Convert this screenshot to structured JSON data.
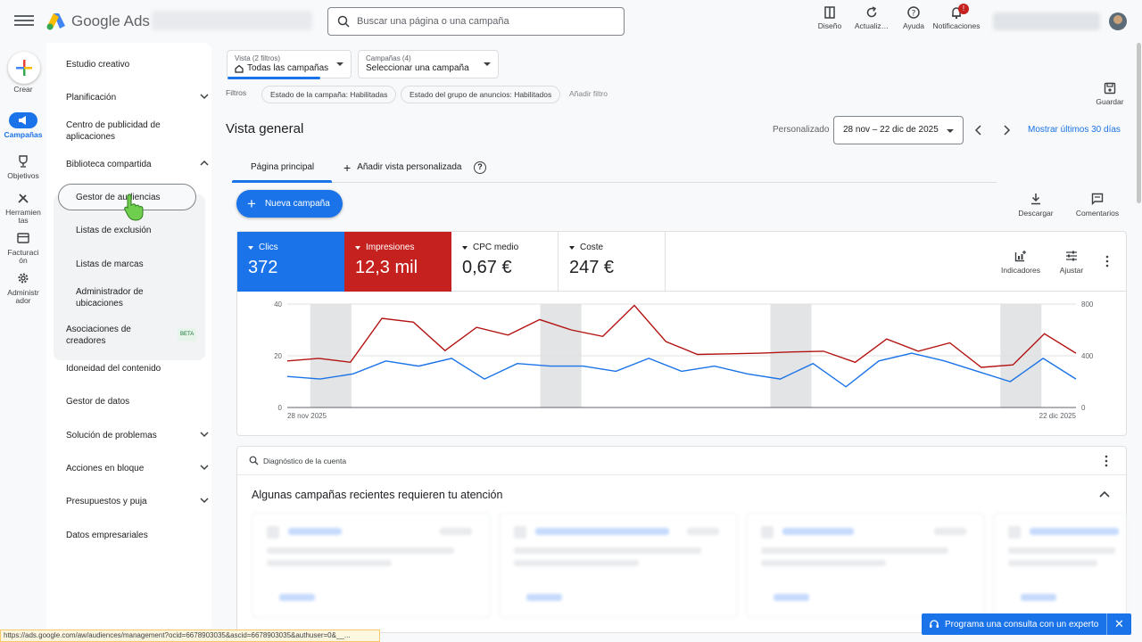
{
  "header": {
    "product_name": "Google Ads",
    "search_placeholder": "Buscar una página o una campaña",
    "tools": [
      {
        "label": "Diseño",
        "icon": "appearance-icon"
      },
      {
        "label": "Actualiz…",
        "icon": "refresh-icon"
      },
      {
        "label": "Ayuda",
        "icon": "help-icon"
      },
      {
        "label": "Notificaciones",
        "icon": "bell-icon",
        "badge": "!"
      }
    ]
  },
  "rail": {
    "create": "Crear",
    "campaigns": "Campañas",
    "goals": "Objetivos",
    "tools": "Herramientas",
    "billing": "Facturación",
    "admin": "Administrador"
  },
  "sidenav": {
    "items": [
      {
        "label": "Estudio creativo"
      },
      {
        "label": "Planificación"
      },
      {
        "label": "Centro de publicidad de aplicaciones"
      },
      {
        "label": "Biblioteca compartida"
      },
      {
        "label": "Gestor de audiencias"
      },
      {
        "label": "Listas de exclusión"
      },
      {
        "label": "Listas de marcas"
      },
      {
        "label": "Administrador de ubicaciones"
      },
      {
        "label": "Asociaciones de creadores",
        "badge": "BETA"
      },
      {
        "label": "Idoneidad del contenido"
      },
      {
        "label": "Gestor de datos"
      },
      {
        "label": "Solución de problemas"
      },
      {
        "label": "Acciones en bloque"
      },
      {
        "label": "Presupuestos y puja"
      },
      {
        "label": "Datos empresariales"
      }
    ]
  },
  "filters": {
    "view_small": "Vista (2 filtros)",
    "view_value": "Todas las campañas",
    "campaigns_small": "Campañas (4)",
    "campaigns_value": "Seleccionar una campaña",
    "label": "Filtros",
    "chips": [
      "Estado de la campaña: Habilitadas",
      "Estado del grupo de anuncios: Habilitados"
    ],
    "add": "Añadir filtro",
    "save": "Guardar"
  },
  "overview": {
    "title": "Vista general",
    "custom": "Personalizado",
    "date_range": "28 nov – 22 dic de 2025",
    "last30": "Mostrar últimos 30 días",
    "tabs": [
      "Página principal",
      "Añadir vista personalizada"
    ],
    "new_campaign": "Nueva campaña",
    "download": "Descargar",
    "comments": "Comentarios"
  },
  "metrics": [
    {
      "label": "Clics",
      "value": "372",
      "color": "#1a73e8"
    },
    {
      "label": "Impresiones",
      "value": "12,3 mil",
      "color": "#c5221f"
    },
    {
      "label": "CPC medio",
      "value": "0,67 €"
    },
    {
      "label": "Coste",
      "value": "247 €"
    }
  ],
  "metric_tools": {
    "indicators": "Indicadores",
    "adjust": "Ajustar"
  },
  "chart_data": {
    "type": "line",
    "x_labels": [
      "28 nov 2025",
      "22 dic 2025"
    ],
    "y_left_ticks": [
      "0",
      "20",
      "40"
    ],
    "y_right_ticks": [
      "0",
      "400",
      "800"
    ],
    "ylim_left": [
      0,
      40
    ],
    "ylim_right": [
      0,
      800
    ],
    "weekend_bands": [
      [
        1,
        2
      ],
      [
        8,
        9
      ],
      [
        15,
        16
      ],
      [
        22,
        23
      ]
    ],
    "series": [
      {
        "name": "Clics",
        "axis": "left",
        "color": "#1a73e8",
        "values": [
          12,
          11,
          13,
          18,
          16,
          19,
          11,
          17,
          16,
          16,
          14,
          19,
          14,
          16,
          13,
          11,
          17,
          8,
          18,
          21,
          18,
          14,
          10,
          19,
          11
        ]
      },
      {
        "name": "Impresiones",
        "axis": "right",
        "color": "#b31412",
        "values": [
          360,
          380,
          350,
          690,
          660,
          440,
          620,
          560,
          680,
          600,
          550,
          790,
          510,
          410,
          415,
          420,
          430,
          435,
          350,
          530,
          435,
          500,
          310,
          330,
          570,
          420
        ]
      }
    ]
  },
  "diagnostics": {
    "title": "Diagnóstico de la cuenta",
    "attention": "Algunas campañas recientes requieren tu atención"
  },
  "status_url": "https://ads.google.com/aw/audiences/management?ocid=6678903035&ascid=6678903035&authuser=0&__...",
  "expert_banner": "Programa una consulta con un experto"
}
